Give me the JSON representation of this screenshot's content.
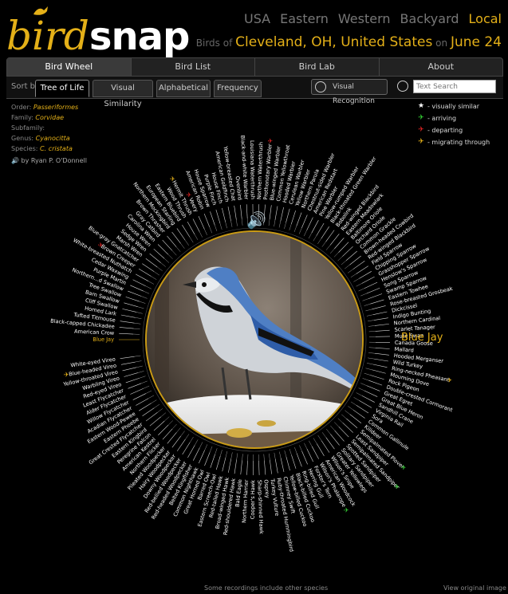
{
  "logo": {
    "bird": "bird",
    "snap": "snap"
  },
  "regions": [
    {
      "label": "USA",
      "active": false
    },
    {
      "label": "Eastern",
      "active": false
    },
    {
      "label": "Western",
      "active": false
    },
    {
      "label": "Backyard",
      "active": false
    },
    {
      "label": "Local",
      "active": true
    }
  ],
  "location": {
    "prefix": "Birds of",
    "city": "Cleveland, OH, United States",
    "on": "on",
    "date": "June 24"
  },
  "nav": [
    "Bird Wheel",
    "Bird List",
    "Bird Lab",
    "About"
  ],
  "sort": {
    "label": "Sort by",
    "tabs": [
      "Tree of Life",
      "Visual Similarity",
      "Alphabetical",
      "Frequency"
    ],
    "visual_recognition": "Visual Recognition",
    "search_placeholder": "Text Search"
  },
  "taxonomy": [
    {
      "label": "Order:",
      "value": "Passeriformes"
    },
    {
      "label": "Family:",
      "value": "Corvidae"
    },
    {
      "label": "Subfamily:",
      "value": ""
    },
    {
      "label": "Genus:",
      "value": "Cyanocitta"
    },
    {
      "label": "Species:",
      "value": "C. cristata"
    }
  ],
  "credit": "by Ryan P. O'Donnell",
  "legend": [
    {
      "label": "- visually similar",
      "color": "#ffffff",
      "icon": "star-icon"
    },
    {
      "label": "- arriving",
      "color": "#33cc33",
      "icon": "bird-arriving-icon"
    },
    {
      "label": "- departing",
      "color": "#dd2222",
      "icon": "bird-departing-icon"
    },
    {
      "label": "- migrating through",
      "color": "#e4b018",
      "icon": "bird-migrating-icon"
    }
  ],
  "selected_bird": "Blue Jay",
  "footer": {
    "note": "Some recordings include other species",
    "view_original": "View original image"
  },
  "colors": {
    "accent": "#e4b018",
    "line": "#d6d6d6"
  },
  "species": [
    "Blue Jay",
    "American Crow",
    "Black-capped Chickadee",
    "Tufted Titmouse",
    "Horned Lark",
    "Cliff Swallow",
    "Barn Swallow",
    "Tree Swallow",
    "Northern...d Swallow",
    "Purple Martin",
    "Cedar Waxwing",
    "White-breasted Nuthatch",
    "Brown Creeper",
    "Blue-gray Gnatcatcher",
    "Marsh Wren",
    "Sedge Wren",
    "House Wren",
    "Carolina Wren",
    "Gray Catbird",
    "Brown Thrasher",
    "Northern Mockingbird",
    "European Starling",
    "Eastern Bluebird",
    "Wood Thrush",
    "Hermit Thrush",
    "Veery",
    "American Robin",
    "House Sparrow",
    "Purple Finch",
    "House Finch",
    "American Goldfinch",
    "Yellow-breasted Chat",
    "Ovenbird",
    "Black-and-white Warbler",
    "Louisiana Waterthrush",
    "Northern Waterthrush",
    "Prothonotary Warbler",
    "Blue-winged Warbler",
    "Common Yellowthroat",
    "Hooded Warbler",
    "Cerulean Warbler",
    "Yellow Warbler",
    "Northern Parula",
    "Chestnut-sided Warbler",
    "American Redstart",
    "Pine Warbler",
    "Yellow-rumped Warbler",
    "Black-throated Green Warbler",
    "Bobolink",
    "Red-winged Blackbird",
    "Eastern Meadowlark",
    "Baltimore Oriole",
    "Orchard Oriole",
    "Common Grackle",
    "Brown-headed Cowbird",
    "Red-winged Blackbird",
    "Field Sparrow",
    "Chipping Sparrow",
    "Grasshopper Sparrow",
    "Henslow's Sparrow",
    "Song Sparrow",
    "Swamp Sparrow",
    "Eastern Towhee",
    "Rose-breasted Grosbeak",
    "Dickcissel",
    "Indigo Bunting",
    "Northern Cardinal",
    "Scarlet Tanager",
    "Mute Swan",
    "Canada Goose",
    "Mallard",
    "Hooded Merganser",
    "Wild Turkey",
    "Ring-necked Pheasant",
    "Mourning Dove",
    "Rock Pigeon",
    "Double-crested Cormorant",
    "Great Egret",
    "Great Blue Heron",
    "Sandhill Crane",
    "Virginia Rail",
    "Sora",
    "Common Gallinule",
    "Killdeer",
    "Semipalmated Plover",
    "Least Sandpiper",
    "Semipalmated Sandpiper",
    "Spotted Sandpiper",
    "Solitary Sandpiper",
    "Greater Yellowlegs",
    "Wilson's Snipe",
    "American Woodcock",
    "Wilson's Phalarope",
    "Forster's Tern",
    "Herring Gull",
    "Ring-billed Gull",
    "Black-billed Cuckoo",
    "Yellow-billed Cuckoo",
    "Chimney Swift",
    "Ruby-throated Hummingbird",
    "Turkey Vulture",
    "Osprey",
    "Sharp-shinned Hawk",
    "Cooper's Hawk",
    "Northern Harrier",
    "Bald Eagle",
    "Red-shouldered Hawk",
    "Broad-winged Hawk",
    "Red-tailed Hawk",
    "Eastern Screech-Owl",
    "Barred Owl",
    "Great Horned Owl",
    "Common Nighthawk",
    "Belted Kingfisher",
    "Red-headed Woodpecker",
    "Red-bellied Woodpecker",
    "Downy Woodpecker",
    "Hairy Woodpecker",
    "Pileated Woodpecker",
    "Northern Flicker",
    "American Kestrel",
    "Peregrine Falcon",
    "Eastern Kingbird",
    "Great Crested Flycatcher",
    "Eastern Phoebe",
    "Eastern Wood-Pewee",
    "Acadian Flycatcher",
    "Willow Flycatcher",
    "Alder Flycatcher",
    "Least Flycatcher",
    "Red-eyed Vireo",
    "Warbling Vireo",
    "Yellow-throated Vireo",
    "Blue-headed Vireo",
    "White-eyed Vireo"
  ],
  "species_marks": {
    "Blue-headed Vireo": "migrating",
    "Brown Creeper": "departing",
    "Hermit Thrush": "migrating",
    "Veery": "departing",
    "Prothonotary Warbler": "departing",
    "Wilson's Phalarope": "arriving",
    "Semipalmated Plover": "arriving",
    "Semipalmated Sandpiper": "arriving",
    "Ring-necked Pheasant": "migrating"
  }
}
